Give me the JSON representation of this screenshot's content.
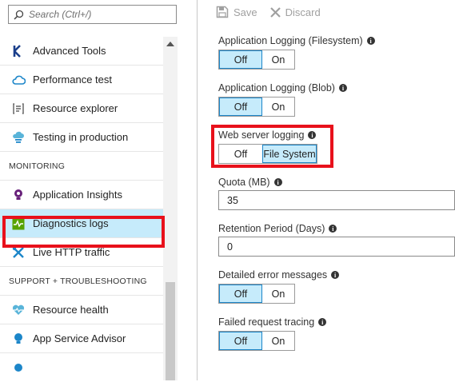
{
  "search": {
    "placeholder": "Search (Ctrl+/)"
  },
  "nav": {
    "items_top": [
      {
        "label": "Advanced Tools",
        "icon": "kudu-icon"
      },
      {
        "label": "Performance test",
        "icon": "cloud-icon"
      },
      {
        "label": "Resource explorer",
        "icon": "explorer-icon"
      },
      {
        "label": "Testing in production",
        "icon": "cloud-test-icon"
      }
    ],
    "section_monitoring": "MONITORING",
    "items_monitoring": [
      {
        "label": "Application Insights",
        "icon": "lightbulb-icon"
      },
      {
        "label": "Diagnostics logs",
        "icon": "pulse-icon"
      },
      {
        "label": "Live HTTP traffic",
        "icon": "tools-icon"
      }
    ],
    "section_support": "SUPPORT + TROUBLESHOOTING",
    "items_support": [
      {
        "label": "Resource health",
        "icon": "heart-icon"
      },
      {
        "label": "App Service Advisor",
        "icon": "advisor-icon"
      }
    ]
  },
  "toolbar": {
    "save_label": "Save",
    "discard_label": "Discard"
  },
  "settings": {
    "app_log_fs": {
      "label": "Application Logging (Filesystem)",
      "off": "Off",
      "on": "On",
      "selected": "Off"
    },
    "app_log_blob": {
      "label": "Application Logging (Blob)",
      "off": "Off",
      "on": "On",
      "selected": "Off"
    },
    "web_server": {
      "label": "Web server logging",
      "off": "Off",
      "fs": "File System",
      "selected": "File System"
    },
    "quota": {
      "label": "Quota (MB)",
      "value": "35"
    },
    "retention": {
      "label": "Retention Period (Days)",
      "value": "0"
    },
    "detailed_errors": {
      "label": "Detailed error messages",
      "off": "Off",
      "on": "On",
      "selected": "Off"
    },
    "failed_request": {
      "label": "Failed request tracing",
      "off": "Off",
      "on": "On",
      "selected": "Off"
    }
  },
  "colors": {
    "accent_bg": "#c6ebfb",
    "accent_border": "#1c86c9",
    "highlight": "#e8111b"
  }
}
